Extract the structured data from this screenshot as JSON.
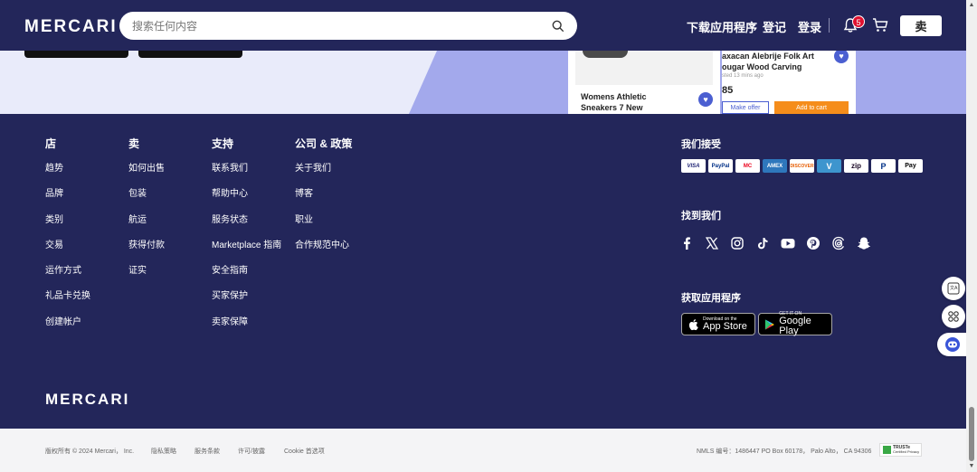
{
  "header": {
    "logo": "MERCARI",
    "search_placeholder": "搜索任何内容",
    "download_app": "下载应用程序",
    "register": "登记",
    "login": "登录",
    "notification_count": "5",
    "sell": "卖"
  },
  "promo": {
    "card1": {
      "title": "Womens Athletic Sneakers 7 New"
    },
    "card2": {
      "title": "axacan Alebrije Folk Art ougar Wood Carving",
      "meta": "sted 13 mins ago",
      "price": "85",
      "make_offer": "Make offer",
      "add_to_cart": "Add to cart"
    }
  },
  "footer": {
    "columns": [
      {
        "heading": "店",
        "items": [
          "趋势",
          "品牌",
          "类别",
          "交易",
          "运作方式",
          "礼品卡兑换",
          "创建帐户"
        ]
      },
      {
        "heading": "卖",
        "items": [
          "如何出售",
          "包装",
          "航运",
          "获得付款",
          "证实"
        ]
      },
      {
        "heading": "支持",
        "items": [
          "联系我们",
          "帮助中心",
          "服务状态",
          "Marketplace 指南",
          "安全指南",
          "买家保护",
          "卖家保障"
        ]
      },
      {
        "heading": "公司 & 政策",
        "items": [
          "关于我们",
          "博客",
          "职业",
          "合作规范中心"
        ]
      }
    ],
    "we_accept": "我们接受",
    "payments": [
      "VISA",
      "PayPal",
      "MC",
      "AMEX",
      "DISCOVER",
      "V",
      "zip",
      "P",
      "Pay"
    ],
    "find_us": "找到我们",
    "get_app": "获取应用程序",
    "app_store": {
      "small": "Download on the",
      "big": "App Store"
    },
    "google_play": {
      "small": "GET IT ON",
      "big": "Google Play"
    },
    "logo": "MERCARI"
  },
  "legal": {
    "copyright": "版权所有 © 2024 Mercari， Inc.",
    "privacy": "隐私策略",
    "terms": "服务条款",
    "license": "许可/披露",
    "cookie": "Cookie 首选项",
    "nmls": "NMLS 编号：1486447 PO Box 60178， Palo Alto， CA 94306",
    "trust_label": "TRUSTe",
    "trust_sub": "Certified Privacy"
  },
  "colors": {
    "navy": "#23265a",
    "promo_bg": "#e9ebfa",
    "accent_blue": "#4b5fd1",
    "orange": "#f58d1b",
    "badge_red": "#e0102f"
  }
}
